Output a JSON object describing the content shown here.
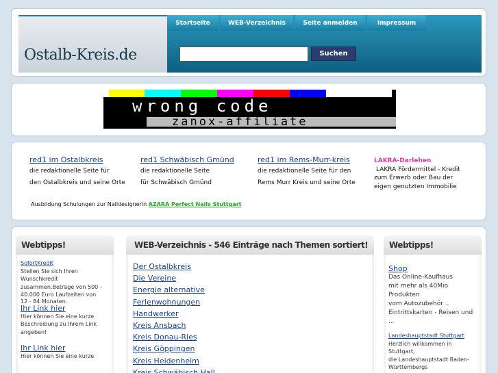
{
  "header": {
    "logo_text": "Ostalb-Kreis.de",
    "tabs": [
      "Startseite",
      "WEB-Verzeichnis",
      "Seite anmelden",
      "Impressum"
    ],
    "search_placeholder": "",
    "search_button": "Suchen"
  },
  "banner": {
    "main_text": "wrong code",
    "sub_text": "zanox-affiliate",
    "strip_colors": [
      "#ffff00",
      "#00ffff",
      "#00ff00",
      "#ff00ff",
      "#ff0000",
      "#0000ff"
    ]
  },
  "links": {
    "col1": {
      "head": "red1 im Ostalbkreis",
      "line1": "die redaktionelle Seite für",
      "line2": "den Ostalbkreis und seine Orte"
    },
    "col2": {
      "head": "red1 Schwäbisch Gmünd",
      "line1": "die redaktionelle Seite",
      "line2": "für Schwäbisch Gmünd"
    },
    "col3": {
      "head": "red1 im Rems-Murr-kreis",
      "line1": "die redaktionelle Seite für den",
      "line2": "Rems Murr Kreis und seine Orte"
    },
    "col4": {
      "head": "LAKRA-Darlehen",
      "line1": "LAKRA Fördermittel - Kredit",
      "line2": "zum Erwerb oder Bau der",
      "line3": "eigen genutzten Immobilie"
    },
    "ausbildung_text": "Ausbildung Schulungen zur Naildesignerin",
    "ausbildung_link": "AZARA Perfect Nails Stuttgart"
  },
  "left_column": {
    "title": "Webtipps!",
    "tips": [
      {
        "link": "SofortKredit",
        "lines": [
          "Stellen Sie sich Ihren",
          "Wunschkredit",
          "zusammen.Beträge von 500 -",
          "40.000 Euro Laufzeiten von",
          "12 - 84 Monaten."
        ]
      },
      {
        "link": "Ihr Link hier",
        "lines": [
          "Hier können Sie eine kurze",
          "Beschreibung zu Ihrem Link",
          "angeben!"
        ]
      },
      {
        "link": "Ihr Link hier",
        "lines": [
          "Hier können Sie eine kurze"
        ]
      }
    ]
  },
  "middle_column": {
    "title": "WEB-Verzeichnis - 546 Einträge nach Themen sortiert!",
    "items": [
      "Der Ostalbkreis",
      "Die Vereine",
      "Energie alternative",
      "Ferienwohnungen",
      "Handwerker",
      "Kreis Ansbach",
      "Kreis Donau-Ries",
      "Kreis Göppingen",
      "Kreis Heidenheim",
      "Kreis Schwäbisch Hall"
    ]
  },
  "right_column": {
    "title": "Webtipps!",
    "tips": [
      {
        "link": "Shop",
        "lines": [
          "Das  Online-Kaufhaus",
          "mit mehr als 40Mio Produkten",
          "vom Autozubehör ..",
          "Eintrittskarten - Reisen und ..."
        ]
      },
      {
        "link": "Landeshauptstadt Stuttgart",
        "lines": [
          "Herzlich willkommen in",
          "Stuttgart,",
          "die Landeshauptstadt Baden-",
          "Württembergs"
        ]
      }
    ]
  }
}
